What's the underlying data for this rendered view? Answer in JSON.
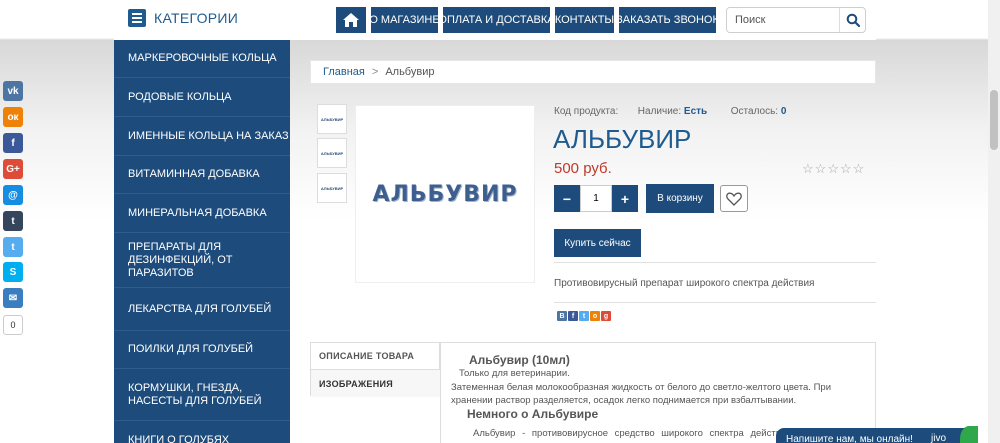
{
  "header": {
    "categories_label": "КАТЕГОРИИ",
    "nav": [
      "О МАГАЗИНЕ",
      "ОПЛАТА И ДОСТАВКА",
      "КОНТАКТЫ",
      "ЗАКАЗАТЬ ЗВОНОК"
    ],
    "search_placeholder": "Поиск"
  },
  "sidebar": {
    "items": [
      "МАРКЕРОВОЧНЫЕ КОЛЬЦА",
      "РОДОВЫЕ КОЛЬЦА",
      "ИМЕННЫЕ КОЛЬЦА НА ЗАКАЗ",
      "ВИТАМИННАЯ ДОБАВКА",
      "МИНЕРАЛЬНАЯ ДОБАВКА",
      "ПРЕПАРАТЫ ДЛЯ ДЕЗИНФЕКЦИЙ, ОТ ПАРАЗИТОВ",
      "ЛЕКАРСТВА ДЛЯ ГОЛУБЕЙ",
      "ПОИЛКИ ДЛЯ ГОЛУБЕЙ",
      "КОРМУШКИ, ГНЕЗДА, НАСЕСТЫ ДЛЯ ГОЛУБЕЙ",
      "КНИГИ О ГОЛУБЯХ"
    ]
  },
  "social": {
    "buttons": [
      {
        "name": "vk",
        "glyph": "vk",
        "color": "#4c75a3"
      },
      {
        "name": "odnoklassniki",
        "glyph": "ок",
        "color": "#ee8208"
      },
      {
        "name": "facebook",
        "glyph": "f",
        "color": "#3b5998"
      },
      {
        "name": "google-plus",
        "glyph": "G+",
        "color": "#dd4b39"
      },
      {
        "name": "moimir",
        "glyph": "@",
        "color": "#168de2"
      },
      {
        "name": "tumblr",
        "glyph": "t",
        "color": "#35465c"
      },
      {
        "name": "twitter",
        "glyph": "t",
        "color": "#55acee"
      },
      {
        "name": "skype",
        "glyph": "S",
        "color": "#00aff0"
      },
      {
        "name": "email",
        "glyph": "✉",
        "color": "#3b7ec0"
      }
    ],
    "count": "0"
  },
  "breadcrumb": {
    "home": "Главная",
    "separator": ">",
    "current": "Альбувир"
  },
  "product": {
    "image_text": "АЛЬБУВИР",
    "thumb_text": "АЛЬБУВИР",
    "code_label": "Код продукта:",
    "stock_label": "Наличие:",
    "stock_value": "Есть",
    "left_label": "Осталось:",
    "left_value": "0",
    "title": "АЛЬБУВИР",
    "price": "500 руб.",
    "rating": 0,
    "rating_max": 5,
    "qty_minus": "−",
    "qty_value": "1",
    "qty_plus": "+",
    "cart_label": "В корзину",
    "buy_now_label": "Купить сейчас",
    "short_description": "Противовирусный препарат широкого спектра действия"
  },
  "share": [
    {
      "name": "vk",
      "glyph": "В",
      "color": "#4c75a3"
    },
    {
      "name": "facebook",
      "glyph": "f",
      "color": "#3b5998"
    },
    {
      "name": "twitter",
      "glyph": "t",
      "color": "#55acee"
    },
    {
      "name": "odnoklassniki",
      "glyph": "о",
      "color": "#ee8208"
    },
    {
      "name": "google-plus",
      "glyph": "g",
      "color": "#dd4b39"
    }
  ],
  "tabs": {
    "description": "ОПИСАНИЕ ТОВАРА",
    "images": "ИЗОБРАЖЕНИЯ"
  },
  "description": {
    "heading1": "Альбувир (10мл)",
    "line1": "Только для ветеринарии.",
    "line2": "Затеменная белая молокообразная жидкость от белого до светло-желтого цвета. При хранении раствор разделяется, осадок легко поднимается при взбалтывании.",
    "heading2": "Немного о Альбувире",
    "line3": "Альбувир - противовирусное средство широкого спектра действия"
  },
  "chat": {
    "label": "Напишите нам, мы онлайн!",
    "brand": "jivo"
  },
  "colors": {
    "primary": "#1d4c7c",
    "link": "#1f5b8e",
    "price": "#c0392b"
  }
}
